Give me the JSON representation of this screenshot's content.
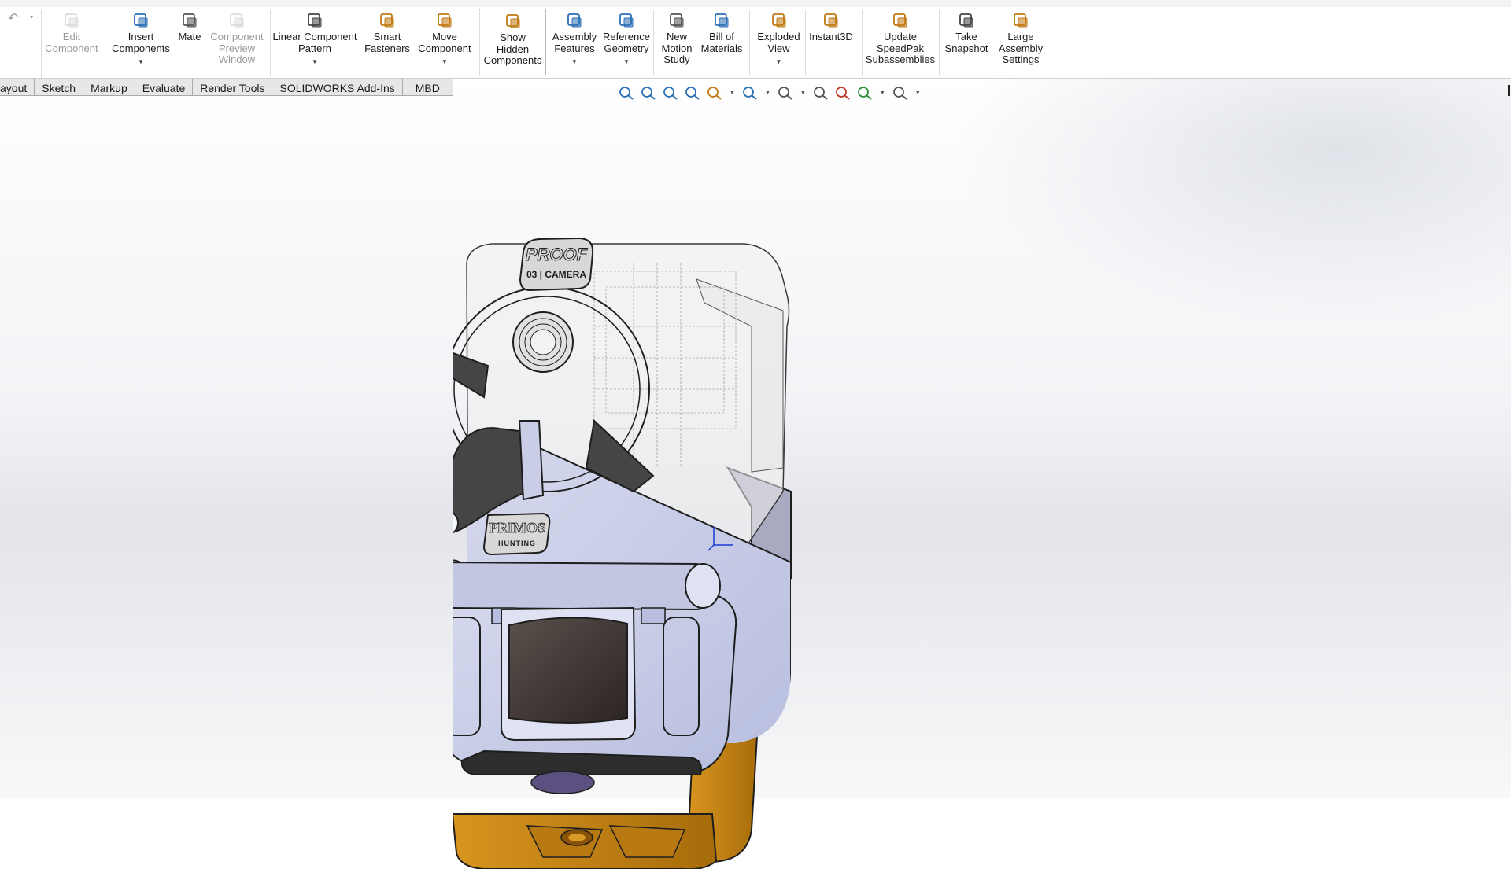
{
  "ribbon": {
    "buttons": [
      {
        "id": "edit-component",
        "label": "Edit\nComponent",
        "disabled": true,
        "caret": false,
        "icon": "edit-component-icon"
      },
      {
        "id": "insert-components",
        "label": "Insert\nComponents",
        "disabled": false,
        "caret": true,
        "icon": "insert-components-icon"
      },
      {
        "id": "mate",
        "label": "Mate",
        "disabled": false,
        "caret": false,
        "icon": "mate-icon"
      },
      {
        "id": "component-preview-window",
        "label": "Component\nPreview\nWindow",
        "disabled": true,
        "caret": false,
        "icon": "preview-window-icon"
      },
      {
        "id": "linear-component-pattern",
        "label": "Linear Component\nPattern",
        "disabled": false,
        "caret": true,
        "icon": "linear-pattern-icon"
      },
      {
        "id": "smart-fasteners",
        "label": "Smart\nFasteners",
        "disabled": false,
        "caret": false,
        "icon": "smart-fasteners-icon"
      },
      {
        "id": "move-component",
        "label": "Move\nComponent",
        "disabled": false,
        "caret": true,
        "icon": "move-component-icon"
      },
      {
        "id": "show-hidden-components",
        "label": "Show\nHidden\nComponents",
        "disabled": false,
        "caret": false,
        "icon": "show-hidden-icon",
        "active": true
      },
      {
        "id": "assembly-features",
        "label": "Assembly\nFeatures",
        "disabled": false,
        "caret": true,
        "icon": "assembly-features-icon"
      },
      {
        "id": "reference-geometry",
        "label": "Reference\nGeometry",
        "disabled": false,
        "caret": true,
        "icon": "reference-geometry-icon"
      },
      {
        "id": "new-motion-study",
        "label": "New\nMotion\nStudy",
        "disabled": false,
        "caret": false,
        "icon": "motion-study-icon"
      },
      {
        "id": "bill-of-materials",
        "label": "Bill of\nMaterials",
        "disabled": false,
        "caret": false,
        "icon": "bill-of-materials-icon"
      },
      {
        "id": "exploded-view",
        "label": "Exploded\nView",
        "disabled": false,
        "caret": true,
        "icon": "exploded-view-icon"
      },
      {
        "id": "instant3d",
        "label": "Instant3D",
        "disabled": false,
        "caret": false,
        "icon": "instant3d-icon"
      },
      {
        "id": "update-speedpak",
        "label": "Update\nSpeedPak\nSubassemblies",
        "disabled": false,
        "caret": false,
        "icon": "speedpak-icon"
      },
      {
        "id": "take-snapshot",
        "label": "Take\nSnapshot",
        "disabled": false,
        "caret": false,
        "icon": "camera-icon"
      },
      {
        "id": "large-assembly-settings",
        "label": "Large\nAssembly\nSettings",
        "disabled": false,
        "caret": false,
        "icon": "large-assembly-icon"
      }
    ]
  },
  "tabs": [
    "ayout",
    "Sketch",
    "Markup",
    "Evaluate",
    "Render Tools",
    "SOLIDWORKS Add-Ins",
    "MBD"
  ],
  "heads_up_toolbar": [
    "zoom-to-fit-icon",
    "zoom-to-area-icon",
    "previous-view-icon",
    "section-view-icon",
    "dynamic-annotation-icon",
    "view-orientation-icon",
    "display-style-icon",
    "hide-show-items-icon",
    "edit-appearance-icon",
    "apply-scene-icon",
    "view-settings-icon"
  ],
  "model": {
    "logo_top_line1": "PROOF",
    "logo_top_line2": "03 | CAMERA",
    "logo_bottom_line1": "PRIMOS",
    "logo_bottom_line2": "HUNTING",
    "colors": {
      "body": "#c9cde6",
      "shadow_body": "#aab0d2",
      "dark": "#454545",
      "lens_dark": "#3a3331",
      "orange": "#c98512",
      "orange_dark": "#9c6408",
      "outline": "#1e1e1e"
    }
  }
}
